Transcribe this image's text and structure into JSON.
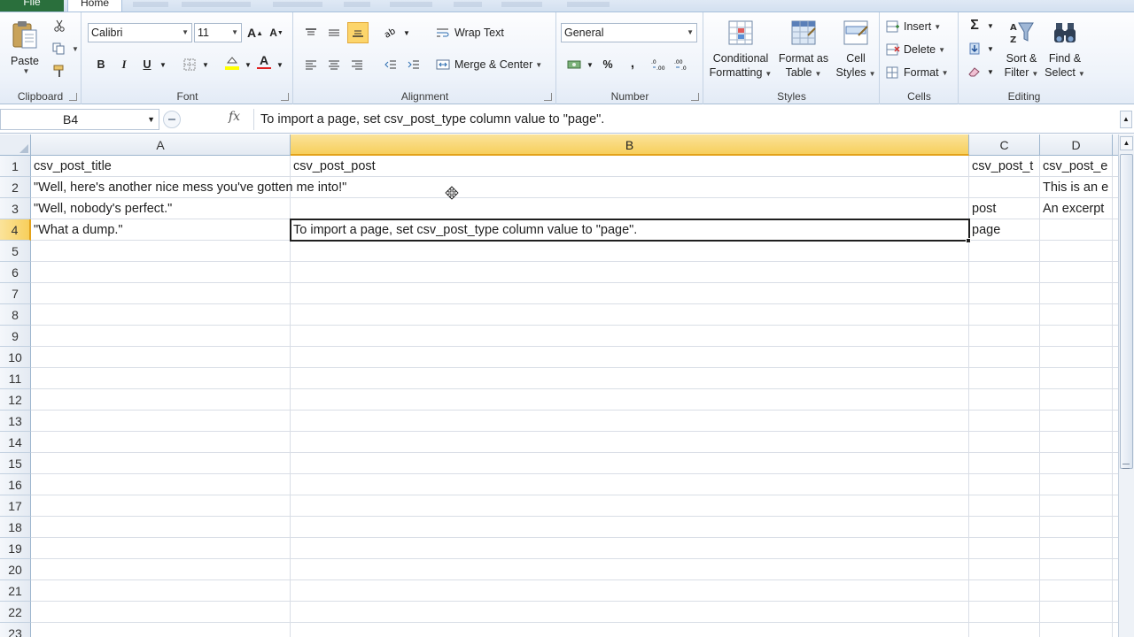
{
  "tabs": {
    "file": "File",
    "home": "Home"
  },
  "clipboard": {
    "paste": "Paste",
    "label": "Clipboard"
  },
  "font": {
    "name": "Calibri",
    "size": "11",
    "bold": "B",
    "italic": "I",
    "underline": "U",
    "label": "Font",
    "highlight_color": "#ffff00",
    "font_color": "#e02020"
  },
  "alignment": {
    "wrap_text": "Wrap Text",
    "merge_center": "Merge & Center",
    "label": "Alignment"
  },
  "number": {
    "format": "General",
    "percent": "%",
    "comma": ",",
    "label": "Number"
  },
  "styles": {
    "conditional_1": "Conditional",
    "conditional_2": "Formatting",
    "format_table_1": "Format as",
    "format_table_2": "Table",
    "cell_styles_1": "Cell",
    "cell_styles_2": "Styles",
    "label": "Styles"
  },
  "cells_group": {
    "insert": "Insert",
    "delete": "Delete",
    "format": "Format",
    "label": "Cells"
  },
  "editing": {
    "sort_1": "Sort &",
    "sort_2": "Filter",
    "find_1": "Find &",
    "find_2": "Select",
    "label": "Editing"
  },
  "formula_bar": {
    "name_box": "B4",
    "fx": "fx",
    "content": "To import a page, set csv_post_type column value to \"page\"."
  },
  "sheet": {
    "columns": [
      "A",
      "B",
      "C",
      "D"
    ],
    "selected_column": "B",
    "selected_row": 4,
    "rows": [
      "1",
      "2",
      "3",
      "4",
      "5",
      "6",
      "7",
      "8",
      "9",
      "10",
      "11",
      "12",
      "13",
      "14",
      "15",
      "16",
      "17",
      "18",
      "19",
      "20",
      "21",
      "22",
      "23"
    ],
    "cells": {
      "A1": "csv_post_title",
      "B1": "csv_post_post",
      "C1": "csv_post_t",
      "D1": "csv_post_e",
      "A2": "\"Well, here's another nice mess you've gotten me into!\"",
      "D2": "This is an e",
      "A3": "\"Well, nobody's perfect.\"",
      "C3": "post",
      "D3": "An excerpt",
      "A4": "\"What a dump.\"",
      "B4": "To import a page, set csv_post_type column value to \"page\".",
      "C4": "page"
    }
  }
}
